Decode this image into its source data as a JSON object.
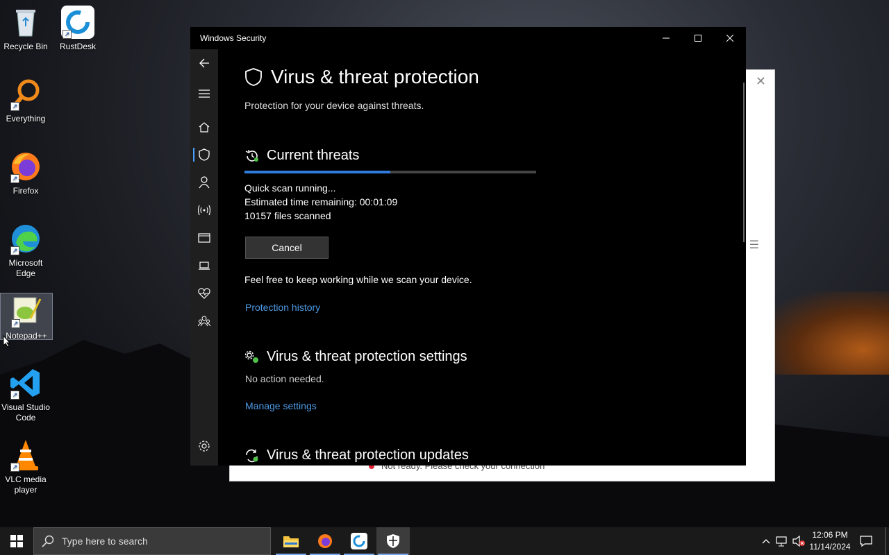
{
  "desktop": {
    "icons": [
      {
        "label": "Recycle Bin"
      },
      {
        "label": "RustDesk"
      },
      {
        "label": "Everything"
      },
      {
        "label": "Firefox"
      },
      {
        "label": "Microsoft Edge"
      },
      {
        "label": "Notepad++"
      },
      {
        "label": "Visual Studio Code"
      },
      {
        "label": "VLC media player"
      }
    ]
  },
  "background_window": {
    "status_text": "Not ready. Please check your connection"
  },
  "window": {
    "title": "Windows Security",
    "page_title": "Virus & threat protection",
    "page_subtitle": "Protection for your device against threats.",
    "current_threats": {
      "heading": "Current threats",
      "progress_percent": 50,
      "status": "Quick scan running...",
      "time_label": "Estimated time remaining:",
      "time_value": "00:01:09",
      "files_count": "10157",
      "files_label": "files scanned",
      "cancel_label": "Cancel",
      "info": "Feel free to keep working while we scan your device.",
      "history_link": "Protection history"
    },
    "settings": {
      "heading": "Virus & threat protection settings",
      "status": "No action needed.",
      "link": "Manage settings"
    },
    "updates": {
      "heading": "Virus & threat protection updates"
    }
  },
  "taskbar": {
    "search_placeholder": "Type here to search",
    "time": "12:06 PM",
    "date": "11/14/2024"
  },
  "colors": {
    "accent": "#2f7be0",
    "link": "#4d9be6",
    "window_bg": "#000000",
    "nav_bg": "#1f1f1f"
  }
}
